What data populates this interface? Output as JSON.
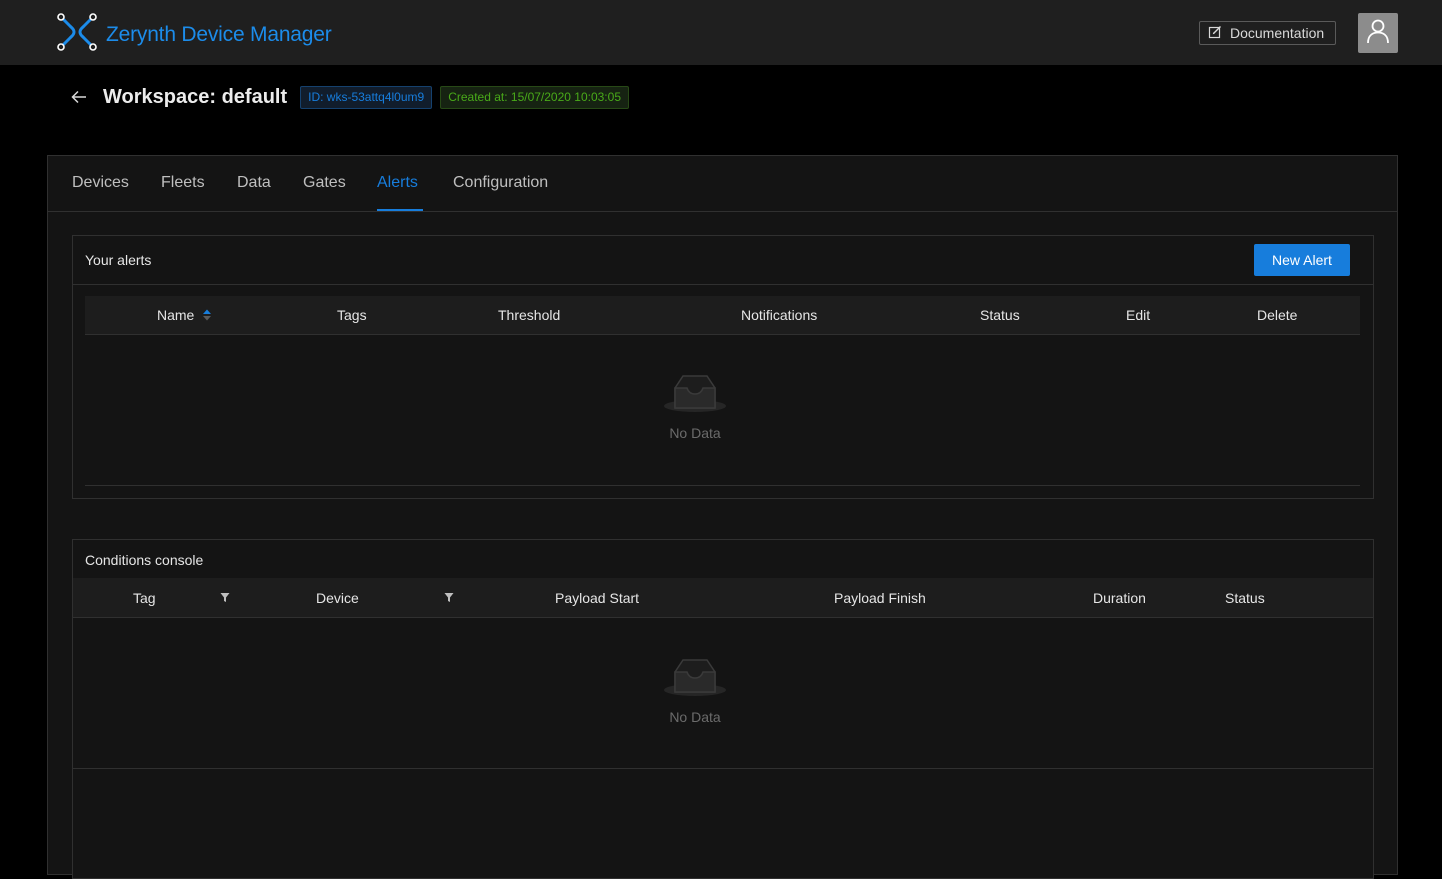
{
  "app": {
    "title": "Zerynth Device Manager"
  },
  "header": {
    "documentation_label": "Documentation"
  },
  "workspace": {
    "title": "Workspace: default",
    "id_tag": "ID: wks-53attq4l0um9",
    "created_tag": "Created at: 15/07/2020 10:03:05"
  },
  "tabs": [
    {
      "label": "Devices"
    },
    {
      "label": "Fleets"
    },
    {
      "label": "Data"
    },
    {
      "label": "Gates"
    },
    {
      "label": "Alerts"
    },
    {
      "label": "Configuration"
    }
  ],
  "active_tab": "Alerts",
  "alerts_panel": {
    "title": "Your alerts",
    "new_alert_label": "New Alert",
    "columns": [
      "Name",
      "Tags",
      "Threshold",
      "Notifications",
      "Status",
      "Edit",
      "Delete"
    ],
    "empty_text": "No Data"
  },
  "conditions_panel": {
    "title": "Conditions console",
    "columns": [
      "Tag",
      "Device",
      "Payload Start",
      "Payload Finish",
      "Duration",
      "Status"
    ],
    "empty_text": "No Data"
  },
  "colors": {
    "accent": "#177ddc",
    "success": "#49aa19",
    "logo": "#1c8cea"
  },
  "icons": [
    "zerynth-logo-icon",
    "edit-icon",
    "user-icon",
    "arrow-left-icon",
    "sort-icon",
    "filter-icon",
    "inbox-empty-icon"
  ]
}
